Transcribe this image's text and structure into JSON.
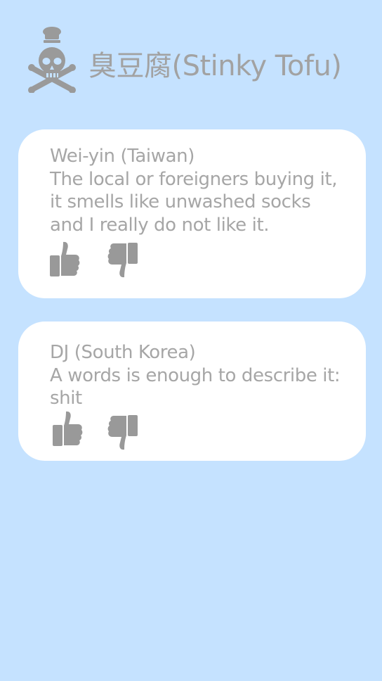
{
  "header": {
    "title": "臭豆腐(Stinky Tofu)",
    "logo_icon": "chef-skull-crossbones-icon"
  },
  "reviews": [
    {
      "author": "Wei-yin (Taiwan)",
      "lines": [
        "The local or foreigners buying it,",
        "it smells like unwashed socks",
        "and I really do not like it."
      ],
      "like_icon": "thumbs-up-icon",
      "dislike_icon": "thumbs-down-icon"
    },
    {
      "author": "DJ (South Korea)",
      "lines": [
        "A words is enough to describe it:",
        "shit"
      ],
      "like_icon": "thumbs-up-icon",
      "dislike_icon": "thumbs-down-icon"
    }
  ],
  "colors": {
    "background": "#c5e2ff",
    "card": "#ffffff",
    "text": "#a6a6a6",
    "icon": "#999999"
  }
}
